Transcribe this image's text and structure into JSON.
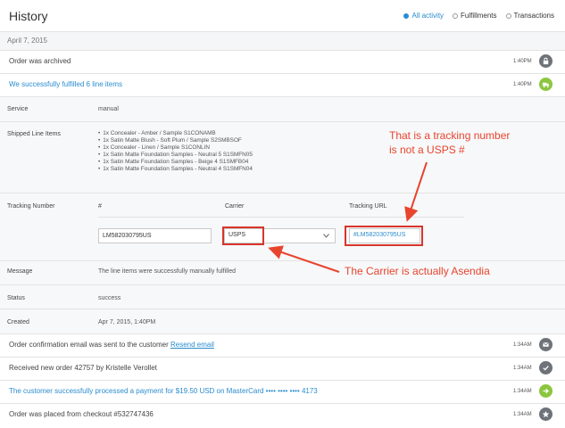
{
  "header": {
    "title": "History"
  },
  "filters": [
    {
      "label": "All activity",
      "active": true
    },
    {
      "label": "Fulfillments",
      "active": false
    },
    {
      "label": "Transactions",
      "active": false
    }
  ],
  "date_label": "April 7, 2015",
  "archived": {
    "text": "Order was archived",
    "time": "1:40PM",
    "icon": "lock-icon"
  },
  "fulfilled": {
    "text": "We successfully fulfilled 6 line items",
    "time": "1:40PM",
    "icon": "truck-icon"
  },
  "details": {
    "service_label": "Service",
    "service_value": "manual",
    "shipped_label": "Shipped Line Items",
    "shipped_items": [
      "1x Concealer - Amber / Sample S1CONAMB",
      "1x Satin Matte Blush - Soft Plum / Sample S2SMBSOF",
      "1x Concealer - Linen / Sample S1CONLIN",
      "1x Satin Matte Foundation Samples - Neutral 5 S1SMFN05",
      "1x Satin Matte Foundation Samples - Beige 4 S1SMFB04",
      "1x Satin Matte Foundation Samples - Neutral 4 S1SMFN04"
    ],
    "tracking_label": "Tracking Number",
    "col_number": "#",
    "col_carrier": "Carrier",
    "col_url": "Tracking URL",
    "tracking_number": "LM582030795US",
    "carrier": "USPS",
    "tracking_url": "#LM582030795US",
    "message_label": "Message",
    "message_value": "The line items were successfully manually fulfilled",
    "status_label": "Status",
    "status_value": "success",
    "created_label": "Created",
    "created_value": "Apr 7, 2015, 1:40PM"
  },
  "annotations": {
    "tracking_note_line1": "That is a tracking number",
    "tracking_note_line2": "is not a USPS #",
    "carrier_note": "The Carrier is actually Asendia"
  },
  "events": [
    {
      "text": "Order confirmation email was sent to the customer",
      "link": "Resend email",
      "time": "1:34AM",
      "icon": "envelope-icon"
    },
    {
      "text": "Received new order 42757 by Kristelle Verollet",
      "time": "1:34AM",
      "icon": "check-icon"
    },
    {
      "text": "The customer successfully processed a payment for $19.50 USD on MasterCard •••• •••• •••• 4173",
      "time": "1:34AM",
      "icon": "arrow-right-icon"
    },
    {
      "text": "Order was placed from checkout #532747436",
      "time": "1:34AM",
      "icon": "star-icon"
    }
  ],
  "colors": {
    "accent": "#2a8ccf",
    "annotation": "#e8452f",
    "green": "#8cc63f",
    "gray_icon": "#6d7378"
  }
}
